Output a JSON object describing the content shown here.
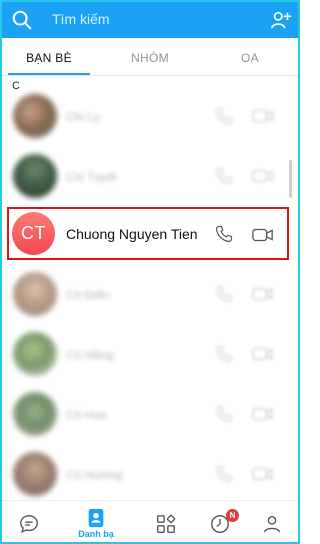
{
  "header": {
    "search_placeholder": "Tìm kiếm"
  },
  "tabs": [
    {
      "label": "BẠN BÈ",
      "active": true
    },
    {
      "label": "NHÓM",
      "active": false
    },
    {
      "label": "OA",
      "active": false
    }
  ],
  "section_letter": "C",
  "contacts": [
    {
      "name": "Chi Ly",
      "blurred": true
    },
    {
      "name": "Chi Tuyết",
      "blurred": true
    },
    {
      "name": "Chuong Nguyen Tien",
      "initials": "CT",
      "blurred": false,
      "highlighted": true
    },
    {
      "name": "Cô Điển",
      "blurred": true
    },
    {
      "name": "Cô Hằng",
      "blurred": true
    },
    {
      "name": "Cô Hoa",
      "blurred": true
    },
    {
      "name": "Cô Hường",
      "blurred": true
    }
  ],
  "bottom_nav": {
    "contacts_label": "Danh bạ",
    "timeline_badge": "N"
  },
  "colors": {
    "brand": "#1aa3f5",
    "highlight": "#d7151b",
    "avatar_ct": "#f04a52"
  }
}
